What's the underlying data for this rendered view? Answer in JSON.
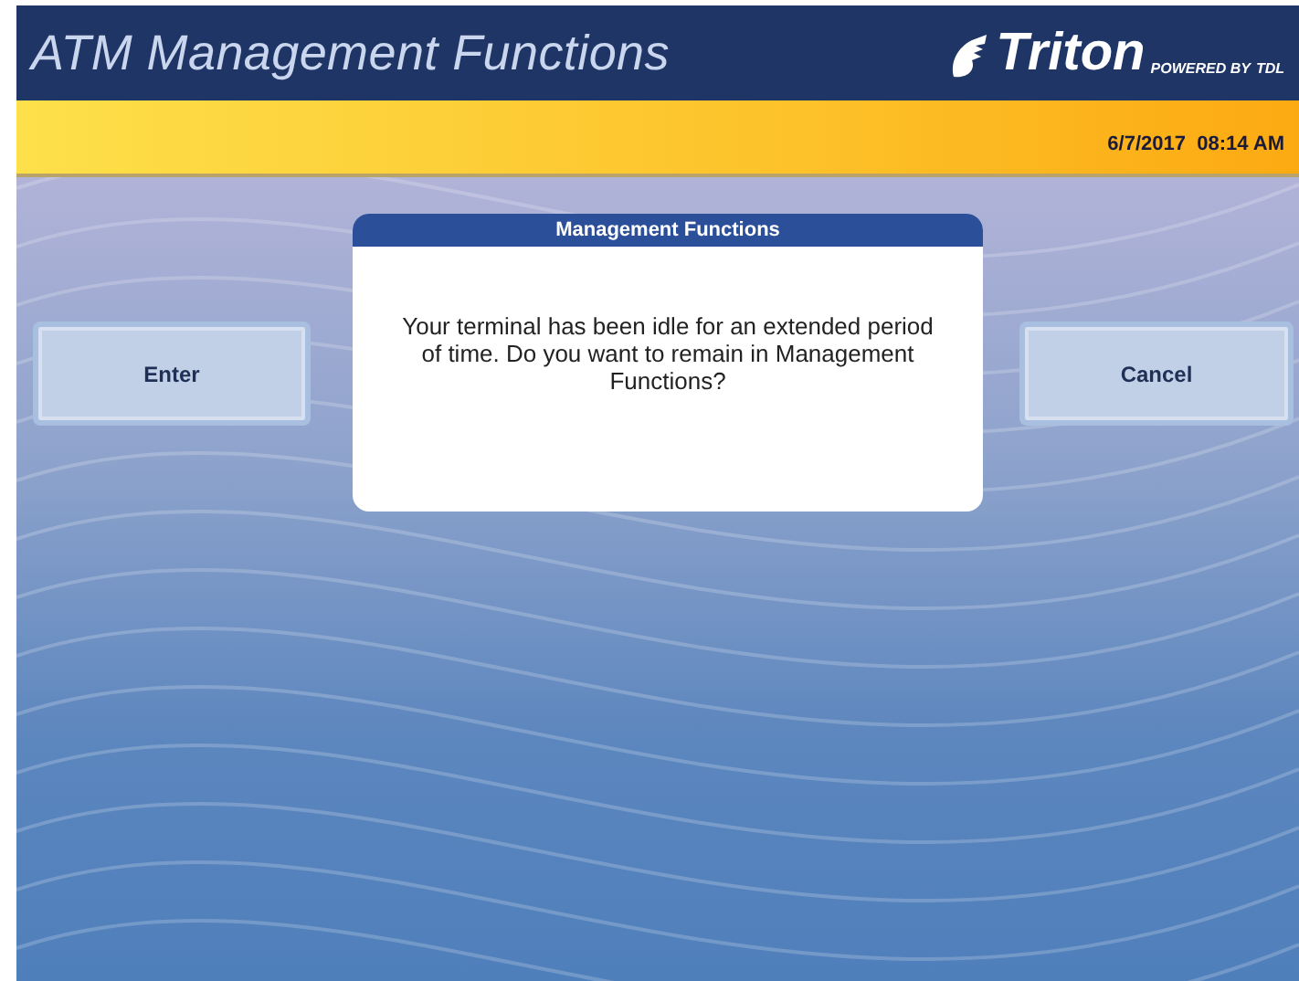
{
  "header": {
    "title": "ATM Management Functions",
    "logo": {
      "brand": "Triton",
      "tagline": "POWERED BY",
      "sub_brand": "TDL"
    }
  },
  "status_bar": {
    "datetime": "6/7/2017  08:14 AM"
  },
  "left_button": {
    "label": "Enter"
  },
  "dialog": {
    "title": "Management Functions",
    "message": "Your terminal has been idle for an extended period of time.  Do you want to remain in Management Functions?"
  },
  "right_button": {
    "label": "Cancel"
  }
}
